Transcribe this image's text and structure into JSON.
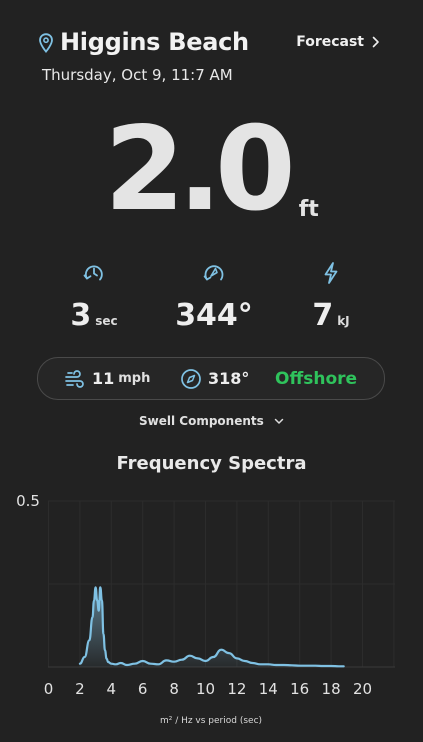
{
  "header": {
    "location": "Higgins Beach",
    "forecast_label": "Forecast",
    "date": "Thursday, Oct 9, 11:7 AM"
  },
  "wave_height": {
    "value": "2.0",
    "unit": "ft"
  },
  "metrics": [
    {
      "name": "period",
      "value": "3",
      "unit": "sec",
      "icon": "period-swirl-icon"
    },
    {
      "name": "direction",
      "value": "344°",
      "unit": "",
      "icon": "compass-needle-icon"
    },
    {
      "name": "energy",
      "value": "7",
      "unit": "kJ",
      "icon": "lightning-bolt-icon"
    }
  ],
  "wind": {
    "speed": "11",
    "speed_unit": "mph",
    "direction": "318°",
    "condition": "Offshore",
    "condition_color": "#2fc35c"
  },
  "swell_components_label": "Swell Components",
  "accent_color": "#7fc1e3",
  "chart_data": {
    "type": "area",
    "title": "Frequency Spectra",
    "xlabel": "m² / Hz vs period (sec)",
    "ylabel": "",
    "xlim": [
      0,
      21
    ],
    "ylim": [
      0,
      0.5
    ],
    "x_ticks": [
      "0",
      "2",
      "4",
      "6",
      "8",
      "10",
      "12",
      "14",
      "16",
      "18",
      "20"
    ],
    "y_ticks": [
      "0.5"
    ],
    "grid": true,
    "series": [
      {
        "x": [
          2.0,
          2.3,
          2.6,
          2.8,
          2.9,
          3.0,
          3.1,
          3.2,
          3.3,
          3.4,
          3.5,
          3.6,
          3.7,
          3.8,
          4.0,
          4.3,
          4.6,
          5.0,
          5.5,
          6.0,
          6.5,
          7.0,
          7.5,
          8.0,
          8.5,
          9.0,
          9.5,
          10.0,
          10.5,
          11.0,
          11.5,
          12.0,
          12.5,
          13.0,
          13.5,
          14.0,
          14.5,
          15.0,
          15.5,
          16.0,
          16.5,
          17.0,
          17.5,
          18.0,
          18.5,
          18.8
        ],
        "y": [
          0.01,
          0.03,
          0.08,
          0.15,
          0.2,
          0.24,
          0.2,
          0.17,
          0.24,
          0.2,
          0.1,
          0.05,
          0.025,
          0.015,
          0.01,
          0.008,
          0.012,
          0.006,
          0.01,
          0.018,
          0.01,
          0.008,
          0.02,
          0.016,
          0.022,
          0.034,
          0.026,
          0.018,
          0.03,
          0.052,
          0.042,
          0.026,
          0.018,
          0.012,
          0.008,
          0.008,
          0.006,
          0.006,
          0.005,
          0.004,
          0.004,
          0.004,
          0.003,
          0.003,
          0.002,
          0.002
        ]
      }
    ]
  }
}
